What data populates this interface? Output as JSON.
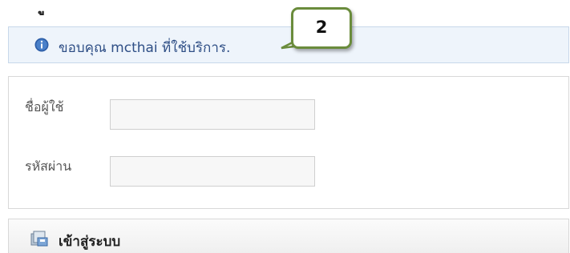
{
  "header": {
    "title_partial": "ู"
  },
  "notice": {
    "text": "ขอบคุณ mcthai ที่ใช้บริการ."
  },
  "callout": {
    "number": "2"
  },
  "form": {
    "username_label": "ชื่อผู้ใช้",
    "username_value": "",
    "password_label": "รหัสผ่าน",
    "password_value": ""
  },
  "login": {
    "label": "เข้าสู่ระบบ"
  },
  "colors": {
    "notice_bg": "#eef4fb",
    "notice_text": "#2f4f86",
    "callout_border": "#6a8c3c"
  },
  "icons": {
    "notice": "info-icon",
    "login": "login-icon"
  }
}
